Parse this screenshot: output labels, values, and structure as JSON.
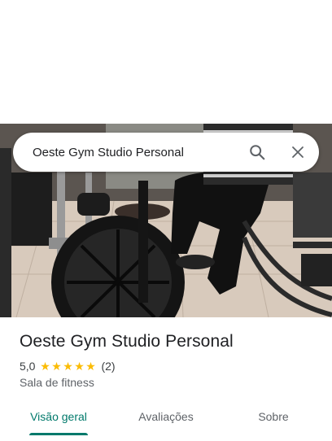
{
  "search": {
    "query": "Oeste Gym Studio Personal"
  },
  "place": {
    "name": "Oeste Gym Studio Personal",
    "rating": "5,0",
    "stars": [
      "★",
      "★",
      "★",
      "★",
      "★"
    ],
    "review_count": "(2)",
    "category": "Sala de fitness"
  },
  "tabs": [
    {
      "label": "Visão geral",
      "active": true
    },
    {
      "label": "Avaliações",
      "active": false
    },
    {
      "label": "Sobre",
      "active": false
    }
  ],
  "colors": {
    "accent": "#00796b",
    "star": "#fbbc04",
    "title": "#202124",
    "secondary": "#5f6368"
  },
  "icons": {
    "search": "search-icon",
    "close": "close-icon"
  }
}
